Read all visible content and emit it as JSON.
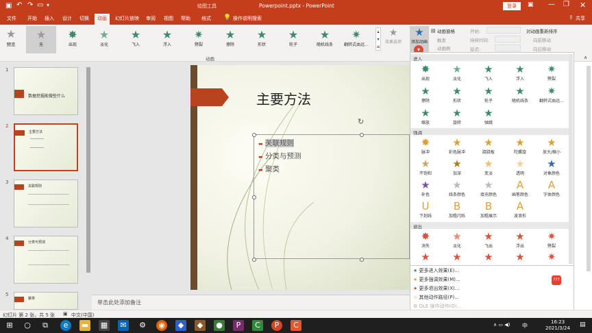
{
  "titlebar": {
    "title": "Powerpoint.pptx - PowerPoint",
    "tool_context": "绘图工具",
    "login": "登录"
  },
  "tabs": [
    "文件",
    "开始",
    "插入",
    "设计",
    "切换",
    "动画",
    "幻灯片放映",
    "审阅",
    "视图",
    "帮助",
    "格式"
  ],
  "tell_me": "操作说明搜索",
  "share": "共享",
  "ribbon": {
    "preview": "预览",
    "gallery": [
      "无",
      "出现",
      "淡化",
      "飞入",
      "浮入",
      "劈裂",
      "擦除",
      "形状",
      "轮子",
      "随机线条",
      "翻转式由远..."
    ],
    "effect_options": "效果选项",
    "add_animation": "添加动画",
    "animation_pane": "动画窗格",
    "trigger": "触发",
    "animation_painter": "动画刷",
    "start_label": "开始:",
    "duration_label": "持续时间:",
    "delay_label": "延迟:",
    "reorder_title": "对动画重新排序",
    "move_earlier": "向前移动",
    "move_later": "向后移动",
    "group_label": "动画"
  },
  "thumbnails": [
    {
      "num": "1",
      "title": "数据挖掘能做些什么"
    },
    {
      "num": "2",
      "title": "主要方法"
    },
    {
      "num": "3",
      "title": "关联规则"
    },
    {
      "num": "4",
      "title": "分类与预测"
    },
    {
      "num": "5",
      "title": "聚类"
    }
  ],
  "slide": {
    "title": "主要方法",
    "bullets": [
      "关联规则",
      "分类与预测",
      "聚类"
    ]
  },
  "notes_placeholder": "单击此处添加备注",
  "panel": {
    "sections": {
      "enter": "进入",
      "emphasis": "强调",
      "exit": "退出"
    },
    "enter_effects": [
      "出现",
      "淡化",
      "飞入",
      "浮入",
      "劈裂",
      "擦除",
      "形状",
      "轮子",
      "随机线条",
      "翻转式由远...",
      "缩放",
      "旋转",
      "弹跳"
    ],
    "emphasis_effects": [
      "脉冲",
      "彩色脉冲",
      "跷跷板",
      "陀螺旋",
      "放大/缩小",
      "不饱和",
      "加深",
      "变淡",
      "透明",
      "对象颜色",
      "补色",
      "线条颜色",
      "填充颜色",
      "画笔颜色",
      "字体颜色",
      "下划线",
      "加粗闪烁",
      "加粗展示",
      "波浪形"
    ],
    "exit_effects": [
      "消失",
      "淡化",
      "飞出",
      "浮出",
      "劈裂"
    ],
    "more": [
      "更多进入效果(E)...",
      "更多强调效果(M)...",
      "更多退出效果(X)...",
      "其他动作路径(P)...",
      "OLE 操作动作(O)..."
    ]
  },
  "status": {
    "slide_info": "幻灯片 第 2 张，共 5 张",
    "language": "中文(中国)"
  },
  "taskbar": {
    "time": "16:23",
    "date": "2021/3/24",
    "ime": "中"
  },
  "colors": {
    "accent": "#c43e1c",
    "enter_star": "#3d8b6f",
    "emphasis_star": "#e0a030",
    "exit_star": "#d9533a"
  }
}
